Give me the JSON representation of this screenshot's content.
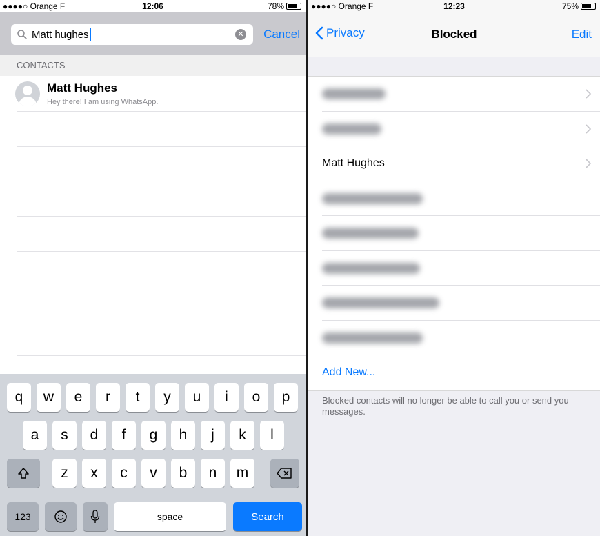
{
  "left": {
    "status": {
      "carrier": "●●●●○ Orange F",
      "time": "12:06",
      "battery": "78%",
      "battery_level": 0.78
    },
    "search": {
      "value": "Matt hughes",
      "cancel": "Cancel"
    },
    "section": "CONTACTS",
    "contact": {
      "name": "Matt Hughes",
      "status": "Hey there! I am using WhatsApp."
    },
    "keyboard": {
      "row1": [
        "q",
        "w",
        "e",
        "r",
        "t",
        "y",
        "u",
        "i",
        "o",
        "p"
      ],
      "row2": [
        "a",
        "s",
        "d",
        "f",
        "g",
        "h",
        "j",
        "k",
        "l"
      ],
      "row3": [
        "z",
        "x",
        "c",
        "v",
        "b",
        "n",
        "m"
      ],
      "numbers": "123",
      "space": "space",
      "search": "Search"
    }
  },
  "right": {
    "status": {
      "carrier": "●●●●○ Orange F",
      "time": "12:23",
      "battery": "75%",
      "battery_level": 0.75
    },
    "nav": {
      "back": "Privacy",
      "title": "Blocked",
      "edit": "Edit"
    },
    "blocked_visible_name": "Matt Hughes",
    "add_new": "Add New...",
    "footer": "Blocked contacts will no longer be able to call you or send you messages."
  },
  "colors": {
    "accent": "#0a7aff",
    "keyboard_bg": "#d1d5db",
    "group_bg": "#efeff4"
  },
  "icons": [
    "search-icon",
    "clear-icon",
    "shift-icon",
    "backspace-icon",
    "emoji-icon",
    "microphone-icon",
    "chevron-left-icon",
    "chevron-right-icon",
    "wifi-icon",
    "battery-icon"
  ]
}
